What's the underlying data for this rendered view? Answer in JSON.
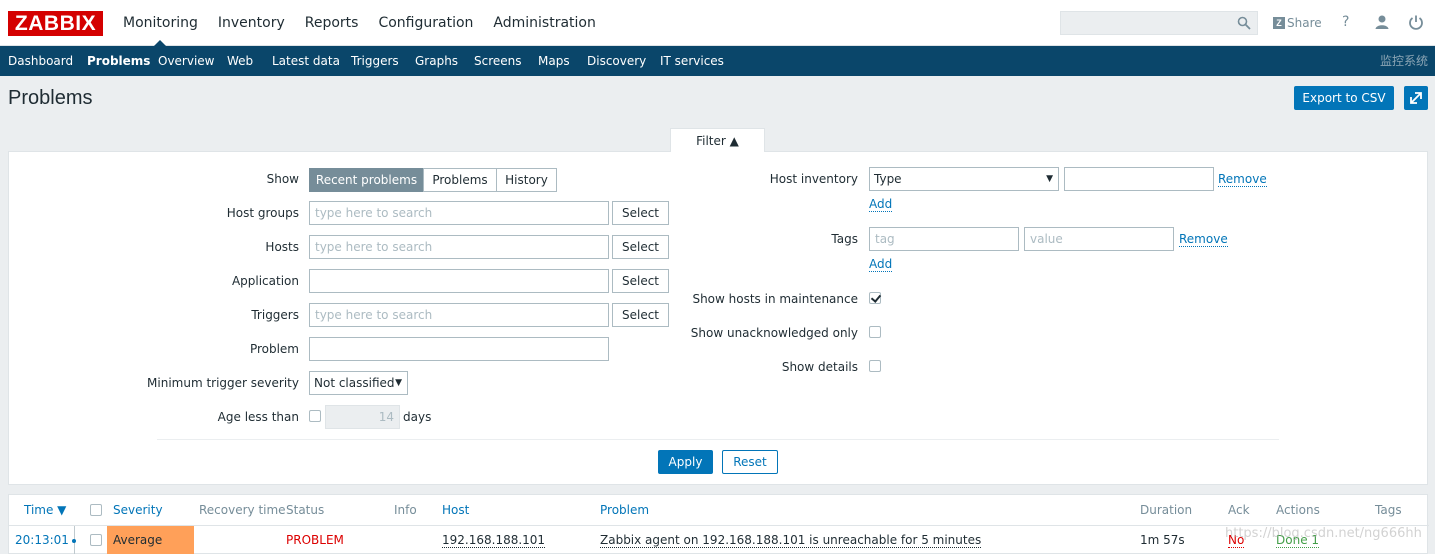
{
  "header": {
    "logo": "ZABBIX",
    "nav": [
      "Monitoring",
      "Inventory",
      "Reports",
      "Configuration",
      "Administration"
    ],
    "share_label": "Share",
    "help_label": "?"
  },
  "subnav": {
    "items": [
      "Dashboard",
      "Problems",
      "Overview",
      "Web",
      "Latest data",
      "Triggers",
      "Graphs",
      "Screens",
      "Maps",
      "Discovery",
      "IT services"
    ],
    "active": "Problems",
    "brand": "监控系统"
  },
  "page": {
    "title": "Problems",
    "export_label": "Export to CSV"
  },
  "filter": {
    "tab_label": "Filter ▲",
    "show_label": "Show",
    "show_options": [
      "Recent problems",
      "Problems",
      "History"
    ],
    "show_selected": "Recent problems",
    "host_groups_label": "Host groups",
    "hosts_label": "Hosts",
    "application_label": "Application",
    "triggers_label": "Triggers",
    "problem_label": "Problem",
    "min_severity_label": "Minimum trigger severity",
    "min_severity_value": "Not classified",
    "age_label": "Age less than",
    "age_value": "14",
    "age_unit": "days",
    "search_placeholder": "type here to search",
    "select_label": "Select",
    "host_inventory_label": "Host inventory",
    "host_inventory_type": "Type",
    "remove_label": "Remove",
    "add_label": "Add",
    "tags_label": "Tags",
    "tag_placeholder": "tag",
    "value_placeholder": "value",
    "maintenance_label": "Show hosts in maintenance",
    "maintenance_checked": true,
    "unack_label": "Show unacknowledged only",
    "details_label": "Show details",
    "apply_label": "Apply",
    "reset_label": "Reset"
  },
  "table": {
    "columns": [
      "Time ▼",
      "Severity",
      "Recovery time",
      "Status",
      "Info",
      "Host",
      "Problem",
      "Duration",
      "Ack",
      "Actions",
      "Tags"
    ],
    "rows": [
      {
        "time": "20:13:01",
        "severity": "Average",
        "recovery_time": "",
        "status": "PROBLEM",
        "info": "",
        "host": "192.168.188.101",
        "problem": "Zabbix agent on 192.168.188.101 is unreachable for 5 minutes",
        "duration": "1m 57s",
        "ack": "No",
        "actions": "Done 1",
        "tags": ""
      }
    ]
  },
  "colors": {
    "accent": "#0275b8",
    "subnav": "#0a466a",
    "logo": "#d40000",
    "average": "#ffa059",
    "problem": "#dc0000",
    "done": "#429e47"
  },
  "watermark": "https://blog.csdn.net/ng666hh"
}
